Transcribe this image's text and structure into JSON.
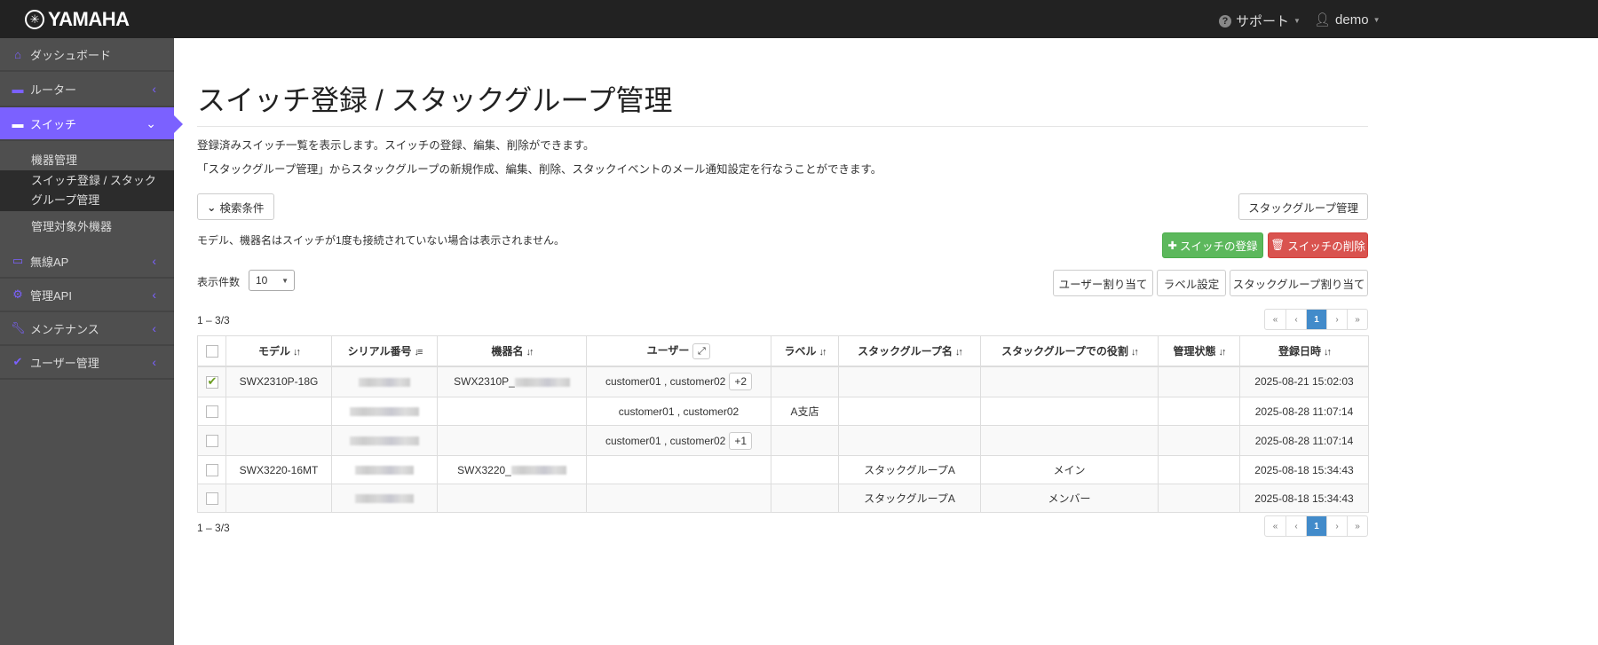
{
  "header": {
    "brand": "YAMAHA",
    "support": "サポート",
    "user": "demo"
  },
  "sidebar": {
    "items": [
      {
        "label": "ダッシュボード",
        "icon": "home-icon"
      },
      {
        "label": "ルーター",
        "icon": "router-icon"
      },
      {
        "label": "スイッチ",
        "icon": "switch-icon"
      },
      {
        "label": "無線AP",
        "icon": "wireless-ap-icon"
      },
      {
        "label": "管理API",
        "icon": "gear-icon"
      },
      {
        "label": "メンテナンス",
        "icon": "wrench-icon"
      },
      {
        "label": "ユーザー管理",
        "icon": "check-icon"
      }
    ],
    "sub": [
      "機器管理",
      "スイッチ登録 / スタックグループ管理",
      "管理対象外機器"
    ]
  },
  "page": {
    "title": "スイッチ登録 / スタックグループ管理",
    "desc1": "登録済みスイッチ一覧を表示します。スイッチの登録、編集、削除ができます。",
    "desc2": "「スタックグループ管理」からスタックグループの新規作成、編集、削除、スタックイベントのメール通知設定を行なうことができます。",
    "search": "検索条件",
    "stack_mgmt": "スタックグループ管理",
    "note": "モデル、機器名はスイッチが1度も接続されていない場合は表示されません。",
    "register": "スイッチの登録",
    "delete": "スイッチの削除",
    "per_page_label": "表示件数",
    "per_page": "10",
    "assign_user": "ユーザー割り当て",
    "label_setting": "ラベル設定",
    "assign_stack": "スタックグループ割り当て",
    "count": "1 – 3/3",
    "pagination": {
      "first": "«",
      "prev": "‹",
      "current": "1",
      "next": "›",
      "last": "»"
    }
  },
  "table": {
    "headers": [
      "モデル",
      "シリアル番号",
      "機器名",
      "ユーザー",
      "ラベル",
      "スタックグループ名",
      "スタックグループでの役割",
      "管理状態",
      "登録日時"
    ],
    "rows": [
      {
        "checked": true,
        "model": "SWX2310P-18G",
        "name_prefix": "SWX2310P_",
        "users": "customer01 , customer02",
        "more": "+2",
        "label": "",
        "stack": "",
        "role": "",
        "state": "",
        "date": "2025-08-21 15:02:03"
      },
      {
        "checked": false,
        "model": "",
        "name_prefix": "",
        "users": "customer01 , customer02",
        "more": "",
        "label": "A支店",
        "stack": "",
        "role": "",
        "state": "",
        "date": "2025-08-28 11:07:14"
      },
      {
        "checked": false,
        "model": "",
        "name_prefix": "",
        "users": "customer01 , customer02",
        "more": "+1",
        "label": "",
        "stack": "",
        "role": "",
        "state": "",
        "date": "2025-08-28 11:07:14"
      },
      {
        "checked": false,
        "model": "SWX3220-16MT",
        "name_prefix": "SWX3220_",
        "users": "",
        "more": "",
        "label": "",
        "stack": "スタックグループA",
        "role": "メイン",
        "state": "",
        "date": "2025-08-18 15:34:43"
      },
      {
        "checked": false,
        "model": "",
        "name_prefix": "",
        "users": "",
        "more": "",
        "label": "",
        "stack": "スタックグループA",
        "role": "メンバー",
        "state": "",
        "date": "2025-08-18 15:34:43"
      }
    ]
  }
}
